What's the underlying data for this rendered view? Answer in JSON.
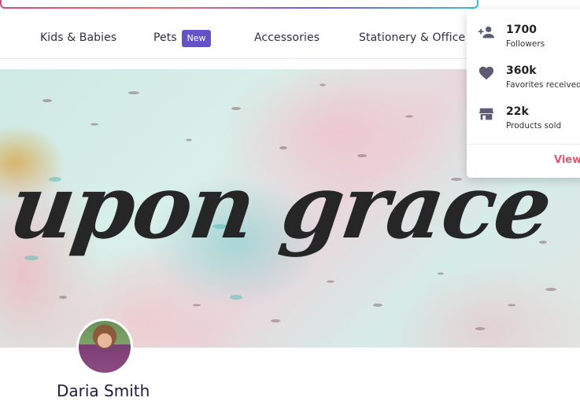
{
  "nav": {
    "items": [
      {
        "label": "Kids & Babies"
      },
      {
        "label": "Pets",
        "badge": "New"
      },
      {
        "label": "Accessories"
      },
      {
        "label": "Stationery & Office"
      }
    ]
  },
  "banner": {
    "title": "upon grace"
  },
  "shop": {
    "owner_name": "Daria Smith"
  },
  "stats_dropdown": {
    "stats": [
      {
        "value": "1700",
        "label": "Followers",
        "icon": "add-person-icon"
      },
      {
        "value": "360k",
        "label": "Favorites received",
        "icon": "heart-icon"
      },
      {
        "value": "22k",
        "label": "Products sold",
        "icon": "store-icon"
      }
    ],
    "view_label": "View"
  },
  "colors": {
    "badge": "#6552c9",
    "link": "#e0556f",
    "icon": "#5c5c74",
    "text": "#1d1b3f"
  }
}
